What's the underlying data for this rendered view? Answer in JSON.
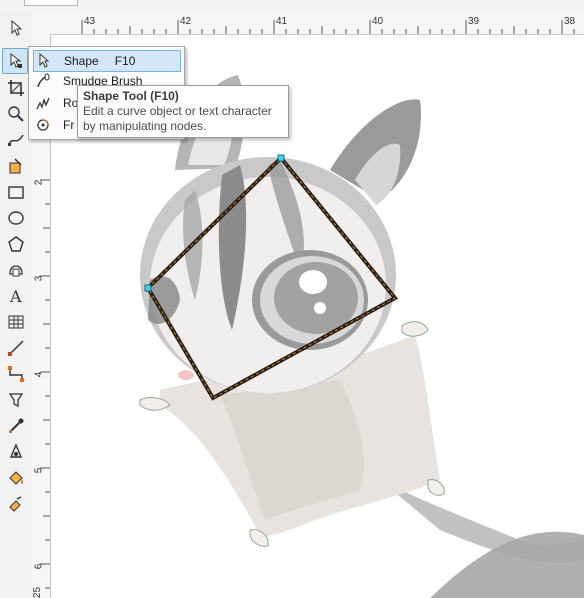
{
  "ruler": {
    "horizontal_labels": [
      "43",
      "42",
      "41",
      "40",
      "39",
      "38"
    ],
    "vertical_labels": [
      "2",
      "3",
      "4",
      "5",
      "6",
      "25"
    ]
  },
  "toolbox": {
    "tools": [
      {
        "name": "pick-tool-icon"
      },
      {
        "name": "shape-tool-icon"
      },
      {
        "name": "crop-tool-icon"
      },
      {
        "name": "zoom-tool-icon"
      },
      {
        "name": "freehand-tool-icon"
      },
      {
        "name": "smart-fill-tool-icon"
      },
      {
        "name": "rectangle-tool-icon"
      },
      {
        "name": "ellipse-tool-icon"
      },
      {
        "name": "polygon-tool-icon"
      },
      {
        "name": "basic-shapes-tool-icon"
      },
      {
        "name": "text-tool-icon"
      },
      {
        "name": "table-tool-icon"
      },
      {
        "name": "dimension-tool-icon"
      },
      {
        "name": "connector-tool-icon"
      },
      {
        "name": "drop-shadow-tool-icon"
      },
      {
        "name": "eyedropper-tool-icon"
      },
      {
        "name": "outline-tool-icon"
      },
      {
        "name": "fill-tool-icon"
      },
      {
        "name": "interactive-fill-tool-icon"
      }
    ]
  },
  "flyout": {
    "items": [
      {
        "label": "Shape",
        "shortcut": "F10",
        "icon": "shape-tool-icon"
      },
      {
        "label": "Smudge Brush",
        "shortcut": "",
        "icon": "smudge-brush-icon"
      },
      {
        "label": "Ro",
        "shortcut": "",
        "icon": "roughen-brush-icon"
      },
      {
        "label": "Fr",
        "shortcut": "",
        "icon": "free-transform-icon"
      }
    ]
  },
  "tooltip": {
    "title": "Shape Tool (F10)",
    "body": "Edit a curve object or text character by manipulating nodes."
  },
  "colors": {
    "accent": "#6aa9d8",
    "selected_node": "#3fd1e8",
    "outline": "#2a2018",
    "dashed_node_line": "#d08030"
  }
}
